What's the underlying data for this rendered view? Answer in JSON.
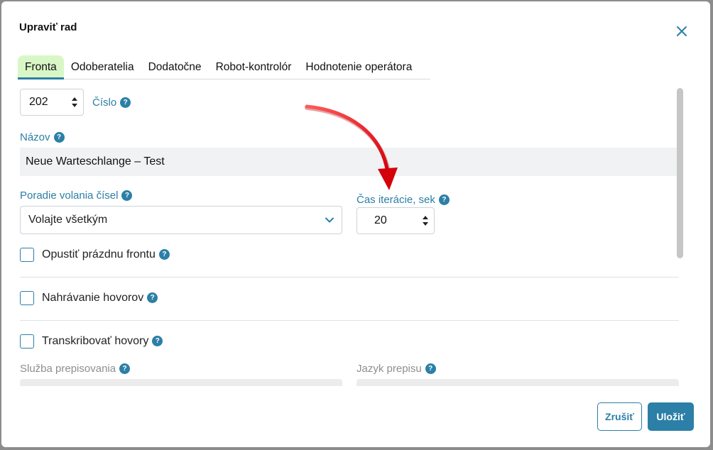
{
  "dialog": {
    "title": "Upraviť rad",
    "close_icon": "close-icon",
    "tabs": [
      {
        "label": "Fronta",
        "active": true
      },
      {
        "label": "Odoberatelia",
        "active": false
      },
      {
        "label": "Dodatočne",
        "active": false
      },
      {
        "label": "Robot-kontrolór",
        "active": false
      },
      {
        "label": "Hodnotenie operátora",
        "active": false
      }
    ],
    "help_glyph": "?"
  },
  "form": {
    "number": {
      "value": "202",
      "label": "Číslo"
    },
    "name": {
      "label": "Názov",
      "value": "Neue Warteschlange – Test"
    },
    "call_order": {
      "label": "Poradie volania čísel",
      "value": "Volajte všetkým"
    },
    "iteration_time": {
      "label": "Čas iterácie, sek",
      "value": "20"
    },
    "leave_empty_queue": {
      "label": "Opustiť prázdnu frontu",
      "checked": false
    },
    "call_recording": {
      "label": "Nahrávanie hovorov",
      "checked": false
    },
    "transcribe_calls": {
      "label": "Transkribovať hovory",
      "checked": false
    },
    "transcription_service": {
      "label": "Služba prepisovania"
    },
    "transcription_language": {
      "label": "Jazyk prepisu"
    }
  },
  "footer": {
    "cancel_label": "Zrušiť",
    "save_label": "Uložiť"
  },
  "colors": {
    "accent": "#2c7fa6",
    "active_tab_bg": "#d9f7c6",
    "annotation_arrow": "#e8000d"
  }
}
